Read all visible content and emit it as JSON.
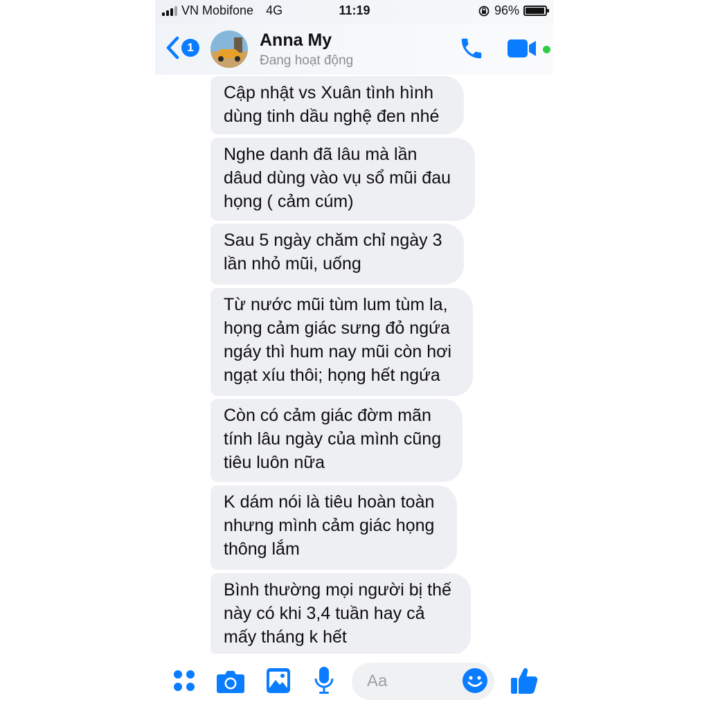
{
  "status_bar": {
    "carrier": "VN Mobifone",
    "network": "4G",
    "time": "11:19",
    "battery_percent": "96%",
    "battery_level": 0.96
  },
  "header": {
    "back_badge": "1",
    "contact_name": "Anna My",
    "contact_status": "Đang hoạt động",
    "icons": [
      "back-chevron-icon",
      "phone-icon",
      "video-camera-icon"
    ],
    "online_color": "#31cc46"
  },
  "messages": [
    {
      "text": "Cập nhật vs Xuân tình hình\ndùng tinh dầu nghệ đen nhé"
    },
    {
      "text": "Nghe danh đã lâu mà lần\ndâud dùng vào vụ sổ mũi đau\nhọng ( cảm cúm)"
    },
    {
      "text": "Sau 5 ngày chăm chỉ ngày 3\nlần nhỏ mũi, uống"
    },
    {
      "text": "Từ nước mũi tùm lum tùm la,\nhọng cảm giác sưng đỏ ngứa\nngáy thì hum nay mũi còn hơi\nngạt xíu thôi; họng hết ngứa"
    },
    {
      "text": "Còn có cảm giác đờm mãn\ntính lâu ngày của mình cũng\ntiêu luôn nữa"
    },
    {
      "text": "K dám nói là tiêu hoàn toàn\nnhưng mình cảm giác họng\nthông lắm"
    },
    {
      "text": "Bình thường mọi người bị thế\nnày có khi 3,4 tuần hay cả\nmấy tháng k hết"
    }
  ],
  "composer": {
    "placeholder": "Aa",
    "icons": [
      "apps-icon",
      "camera-icon",
      "image-icon",
      "microphone-icon",
      "emoji-icon",
      "thumbs-up-icon"
    ]
  },
  "colors": {
    "accent": "#0a7cff",
    "bubble_bg": "#eeeff2"
  }
}
